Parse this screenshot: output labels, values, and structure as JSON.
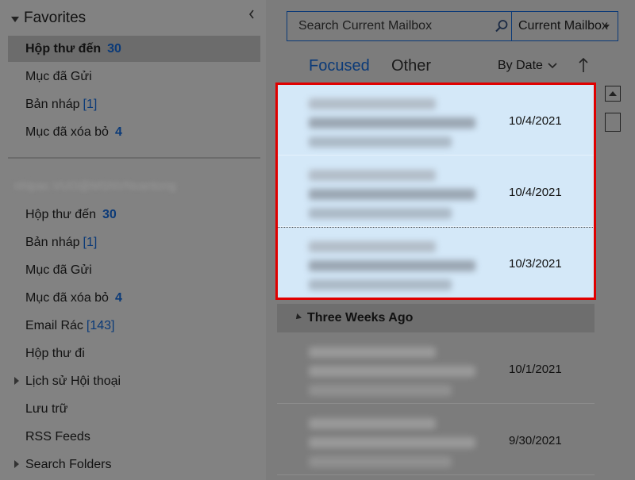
{
  "favorites": {
    "header": "Favorites",
    "items": [
      {
        "label": "Hộp thư đến",
        "count": "30",
        "selected": true
      },
      {
        "label": "Mục đã Gửi",
        "count": ""
      },
      {
        "label": "Bản nháp",
        "count": "[1]"
      },
      {
        "label": "Mục đã xóa bỏ",
        "count": "4"
      }
    ]
  },
  "account": {
    "name": "nhipac.VUO@MSNVNvantong",
    "items": [
      {
        "label": "Hộp thư đến",
        "count": "30"
      },
      {
        "label": "Bản nháp",
        "count": "[1]"
      },
      {
        "label": "Mục đã Gửi",
        "count": ""
      },
      {
        "label": "Mục đã xóa bỏ",
        "count": "4"
      },
      {
        "label": "Email Rác",
        "count": "[143]"
      },
      {
        "label": "Hộp thư đi",
        "count": ""
      },
      {
        "label": "Lịch sử Hội thoại",
        "count": ""
      },
      {
        "label": "Lưu trữ",
        "count": ""
      },
      {
        "label": "RSS Feeds",
        "count": ""
      },
      {
        "label": "Search Folders",
        "count": ""
      }
    ]
  },
  "search": {
    "placeholder": "Search Current Mailbox",
    "scope": "Current Mailbox"
  },
  "tabs": {
    "focused": "Focused",
    "other": "Other"
  },
  "sort": {
    "label": "By Date"
  },
  "mail": {
    "items": [
      {
        "date": "10/4/2021"
      },
      {
        "date": "10/4/2021"
      },
      {
        "date": "10/3/2021"
      },
      {
        "date": "10/1/2021"
      },
      {
        "date": "9/30/2021"
      }
    ],
    "group_label": "Three Weeks Ago"
  },
  "colors": {
    "accent": "#0b3a78",
    "highlight": "#d4e8f8",
    "annotation_frame": "#e00000"
  }
}
